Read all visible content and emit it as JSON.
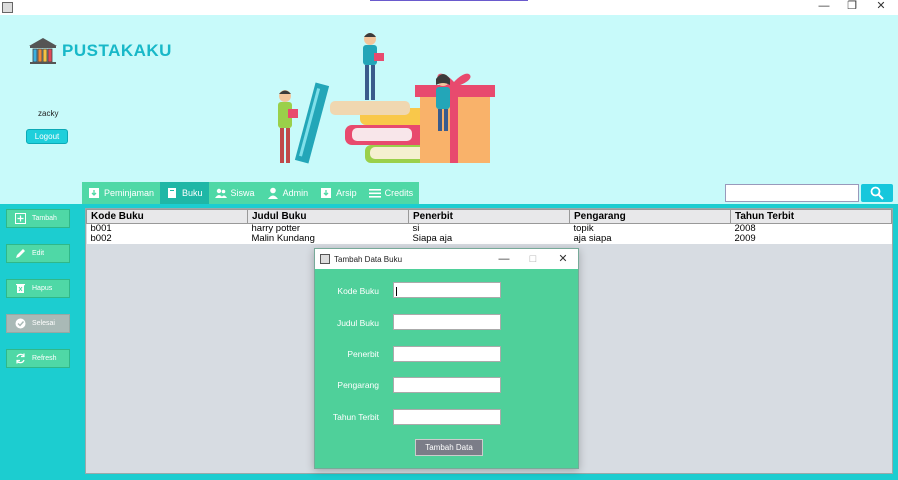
{
  "window": {
    "minimize_glyph": "—",
    "restore_glyph": "❐",
    "close_glyph": "✕"
  },
  "header": {
    "app_name": "PUSTAKAKU",
    "username": "zacky",
    "logout_label": "Logout"
  },
  "tabs": [
    {
      "label": "Peminjaman",
      "icon": "download-icon"
    },
    {
      "label": "Buku",
      "icon": "book-icon",
      "active": true
    },
    {
      "label": "Siswa",
      "icon": "users-icon"
    },
    {
      "label": "Admin",
      "icon": "user-icon"
    },
    {
      "label": "Arsip",
      "icon": "archive-icon"
    },
    {
      "label": "Credits",
      "icon": "menu-icon"
    }
  ],
  "search": {
    "value": "",
    "icon": "search-icon"
  },
  "sidebar": [
    {
      "label": "Tambah",
      "icon": "add-icon"
    },
    {
      "label": "Edit",
      "icon": "pencil-icon"
    },
    {
      "label": "Hapus",
      "icon": "trash-icon"
    },
    {
      "label": "Selesai",
      "icon": "check-icon",
      "disabled": true
    },
    {
      "label": "Refresh",
      "icon": "refresh-icon"
    }
  ],
  "table": {
    "columns": [
      "Kode Buku",
      "Judul Buku",
      "Penerbit",
      "Pengarang",
      "Tahun Terbit"
    ],
    "rows": [
      [
        "b001",
        "harry potter",
        "si",
        "topik",
        "2008"
      ],
      [
        "b002",
        "Malin Kundang",
        "Siapa aja",
        "aja siapa",
        "2009"
      ]
    ]
  },
  "dialog": {
    "title": "Tambah Data Buku",
    "fields": [
      {
        "label": "Kode Buku",
        "value": ""
      },
      {
        "label": "Judul Buku",
        "value": ""
      },
      {
        "label": "Penerbit",
        "value": ""
      },
      {
        "label": "Pengarang",
        "value": ""
      },
      {
        "label": "Tahun Terbit",
        "value": ""
      }
    ],
    "submit_label": "Tambah Data"
  },
  "colors": {
    "header_bg": "#c8fafa",
    "accent": "#4fd8a6",
    "body_bg": "#1ccdd0",
    "logo": "#18b8c8"
  }
}
